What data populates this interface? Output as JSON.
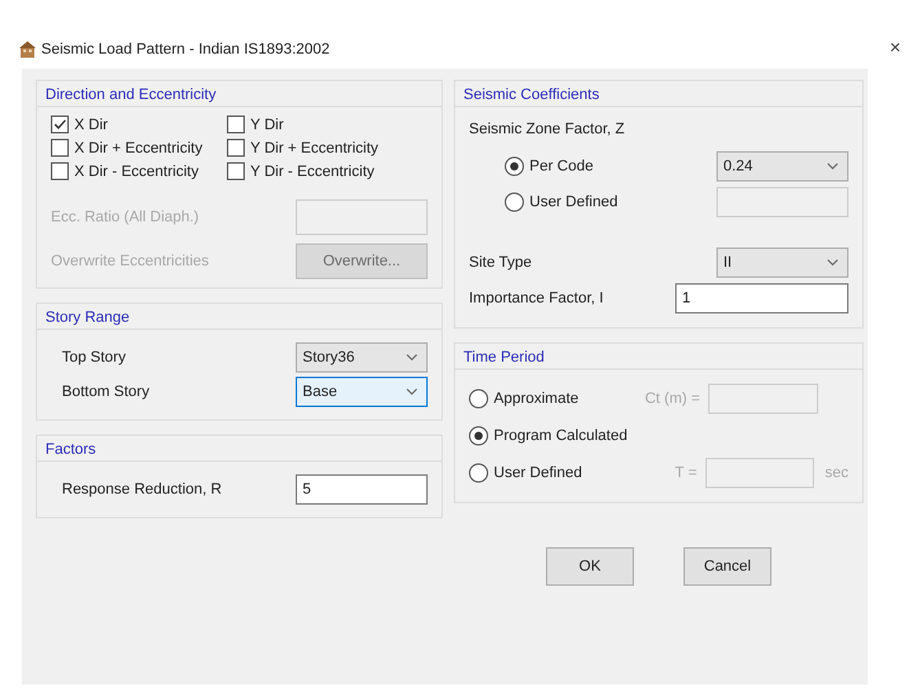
{
  "window": {
    "title": "Seismic Load Pattern - Indian IS1893:2002",
    "close": "×"
  },
  "direction": {
    "title": "Direction and Eccentricity",
    "checkboxes": [
      {
        "label": "X Dir",
        "checked": true
      },
      {
        "label": "Y Dir",
        "checked": false
      },
      {
        "label": "X Dir + Eccentricity",
        "checked": false
      },
      {
        "label": "Y Dir + Eccentricity",
        "checked": false
      },
      {
        "label": "X Dir - Eccentricity",
        "checked": false
      },
      {
        "label": "Y Dir - Eccentricity",
        "checked": false
      }
    ],
    "ecc_ratio": {
      "label": "Ecc. Ratio (All Diaph.)",
      "disabled": true
    },
    "overwrite": {
      "label": "Overwrite Eccentricities",
      "button": "Overwrite...",
      "disabled": true
    }
  },
  "story_range": {
    "title": "Story Range",
    "rows": [
      {
        "label": "Top Story",
        "value": "Story36",
        "focused": false
      },
      {
        "label": "Bottom Story",
        "value": "Base",
        "focused": true
      }
    ]
  },
  "factors": {
    "title": "Factors",
    "fields": [
      {
        "label": "Response Reduction, R",
        "value": "5"
      }
    ]
  },
  "seismic_coefficients": {
    "title": "Seismic Coefficients",
    "zone_label": "Seismic Zone Factor, Z",
    "options": [
      {
        "label": "Per Code",
        "selected": true,
        "kind": "dropdown",
        "value": "0.24"
      },
      {
        "label": "User Defined",
        "selected": false,
        "kind": "field"
      }
    ],
    "site_type": {
      "label": "Site Type",
      "value": "II"
    },
    "importance": {
      "label": "Importance Factor, I",
      "value": "1"
    }
  },
  "time_period": {
    "title": "Time Period",
    "options": [
      {
        "label": "Approximate",
        "selected": false,
        "field_label": "Ct (m) ="
      },
      {
        "label": "Program Calculated",
        "selected": true
      },
      {
        "label": "User Defined",
        "selected": false,
        "field_label": "T =",
        "unit": "sec"
      }
    ]
  },
  "buttons": [
    "OK",
    "Cancel"
  ]
}
